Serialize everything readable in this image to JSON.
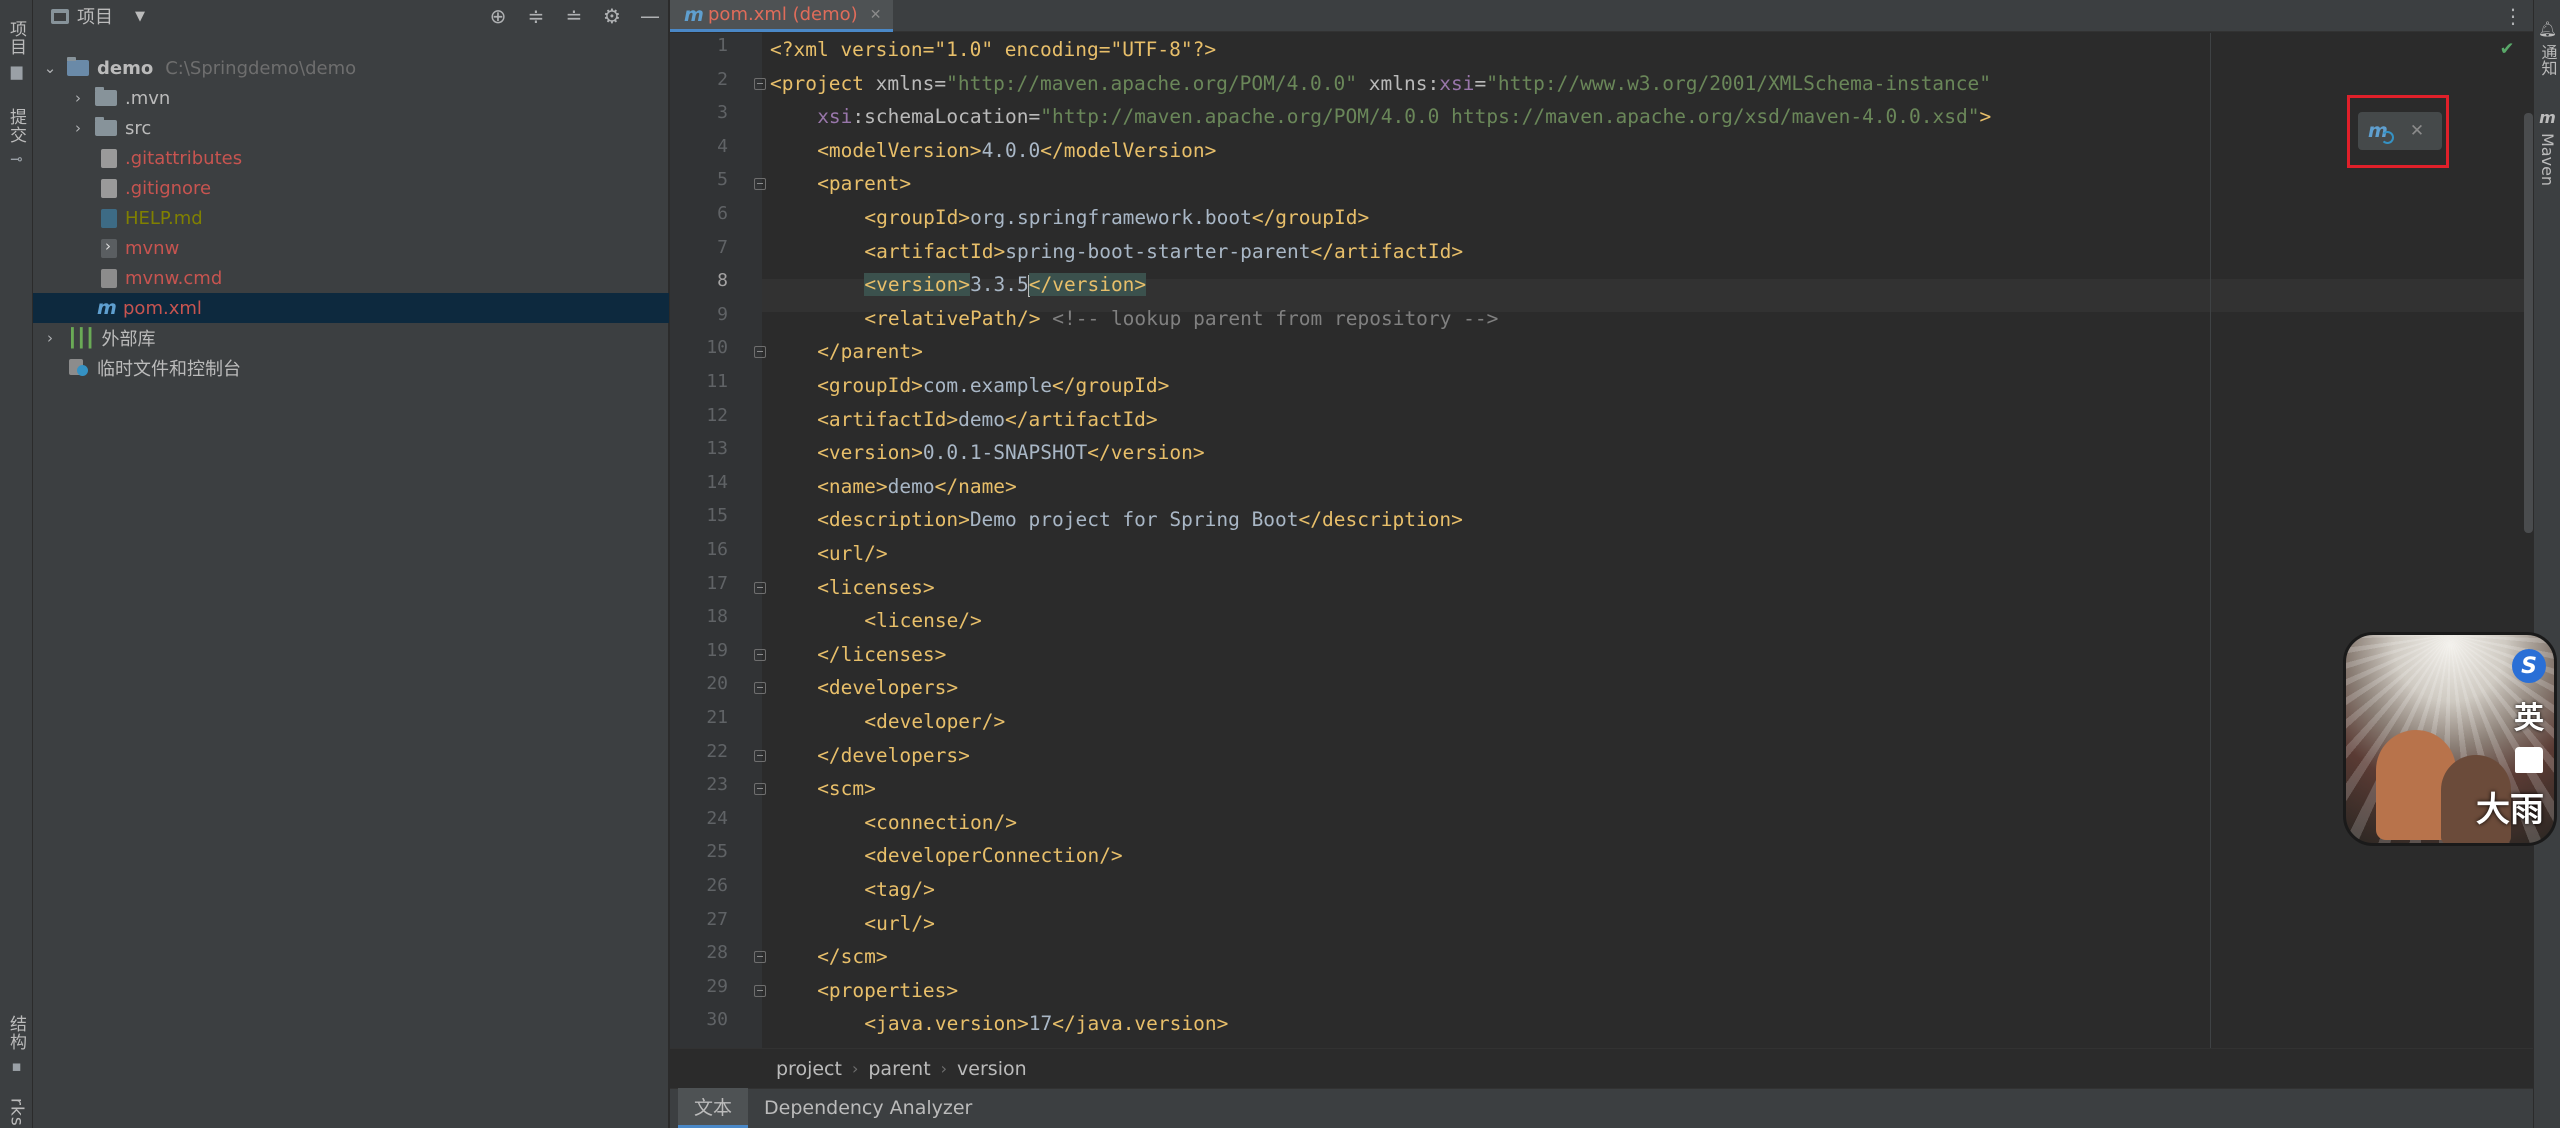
{
  "left_strip": {
    "project_tab": "项目",
    "commit_tab": "提交",
    "structure_tab": "结构",
    "bookmarks_tab": "rks"
  },
  "project_panel": {
    "title": "项目",
    "tree": [
      {
        "label": "demo",
        "path": "C:\\Springdemo\\demo",
        "kind": "root"
      },
      {
        "label": ".mvn",
        "kind": "folder"
      },
      {
        "label": "src",
        "kind": "folder"
      },
      {
        "label": ".gitattributes",
        "kind": "file",
        "color": "red"
      },
      {
        "label": ".gitignore",
        "kind": "file",
        "color": "red"
      },
      {
        "label": "HELP.md",
        "kind": "file",
        "color": "olive"
      },
      {
        "label": "mvnw",
        "kind": "file",
        "color": "red"
      },
      {
        "label": "mvnw.cmd",
        "kind": "file",
        "color": "red"
      },
      {
        "label": "pom.xml",
        "kind": "file",
        "color": "red"
      },
      {
        "label": "外部库",
        "kind": "library"
      },
      {
        "label": "临时文件和控制台",
        "kind": "scratch"
      }
    ]
  },
  "editor": {
    "tab_label": "pom.xml (demo)",
    "current_line": 8,
    "lines": [
      "1",
      "2",
      "3",
      "4",
      "5",
      "6",
      "7",
      "8",
      "9",
      "10",
      "11",
      "12",
      "13",
      "14",
      "15",
      "16",
      "17",
      "18",
      "19",
      "20",
      "21",
      "22",
      "23",
      "24",
      "25",
      "26",
      "27",
      "28",
      "29",
      "30"
    ],
    "code": {
      "l1_decl": "<?xml version=\"1.0\" encoding=\"UTF-8\"?>",
      "l2_open": "<project",
      "l2_attr1": " xmlns=",
      "l2_val1": "\"http://maven.apache.org/POM/4.0.0\"",
      "l2_attr2": " xmlns:",
      "l2_ns": "xsi",
      "l2_eq": "=",
      "l2_val2": "\"http://www.w3.org/2001/XMLSchema-instance\"",
      "l3_ns": "xsi",
      "l3_attr": ":schemaLocation=",
      "l3_val": "\"http://maven.apache.org/POM/4.0.0 https://maven.apache.org/xsd/maven-4.0.0.xsd\"",
      "l3_close": ">",
      "l4_open": "<modelVersion>",
      "l4_text": "4.0.0",
      "l4_close": "</modelVersion>",
      "l5": "<parent>",
      "l6_open": "<groupId>",
      "l6_text": "org.springframework.boot",
      "l6_close": "</groupId>",
      "l7_open": "<artifactId>",
      "l7_text": "spring-boot-starter-parent",
      "l7_close": "</artifactId>",
      "l8_open": "<version>",
      "l8_text": "3.3.5",
      "l8_close": "</version>",
      "l9_tag": "<relativePath/>",
      "l9_cmt": " <!-- lookup parent from repository -->",
      "l10": "</parent>",
      "l11_open": "<groupId>",
      "l11_text": "com.example",
      "l11_close": "</groupId>",
      "l12_open": "<artifactId>",
      "l12_text": "demo",
      "l12_close": "</artifactId>",
      "l13_open": "<version>",
      "l13_text": "0.0.1-SNAPSHOT",
      "l13_close": "</version>",
      "l14_open": "<name>",
      "l14_text": "demo",
      "l14_close": "</name>",
      "l15_open": "<description>",
      "l15_text": "Demo project for Spring Boot",
      "l15_close": "</description>",
      "l16": "<url/>",
      "l17": "<licenses>",
      "l18": "<license/>",
      "l19": "</licenses>",
      "l20": "<developers>",
      "l21": "<developer/>",
      "l22": "</developers>",
      "l23": "<scm>",
      "l24": "<connection/>",
      "l25": "<developerConnection/>",
      "l26": "<tag/>",
      "l27": "<url/>",
      "l28": "</scm>",
      "l29": "<properties>",
      "l30_open": "<java.version>",
      "l30_text": "17",
      "l30_close": "</java.version>"
    }
  },
  "breadcrumb": [
    "project",
    "parent",
    "version"
  ],
  "bottom_tabs": {
    "text_tab": "文本",
    "analyzer_tab": "Dependency Analyzer"
  },
  "right_strip": {
    "notifications_tab": "通知",
    "maven_tab": "Maven"
  },
  "avatar_widget": {
    "badge": "S",
    "char1": "英",
    "char2": "大雨"
  },
  "colors": {
    "accent": "#4a88c7",
    "popup_border": "#e0202a",
    "selection": "#0d293e"
  }
}
